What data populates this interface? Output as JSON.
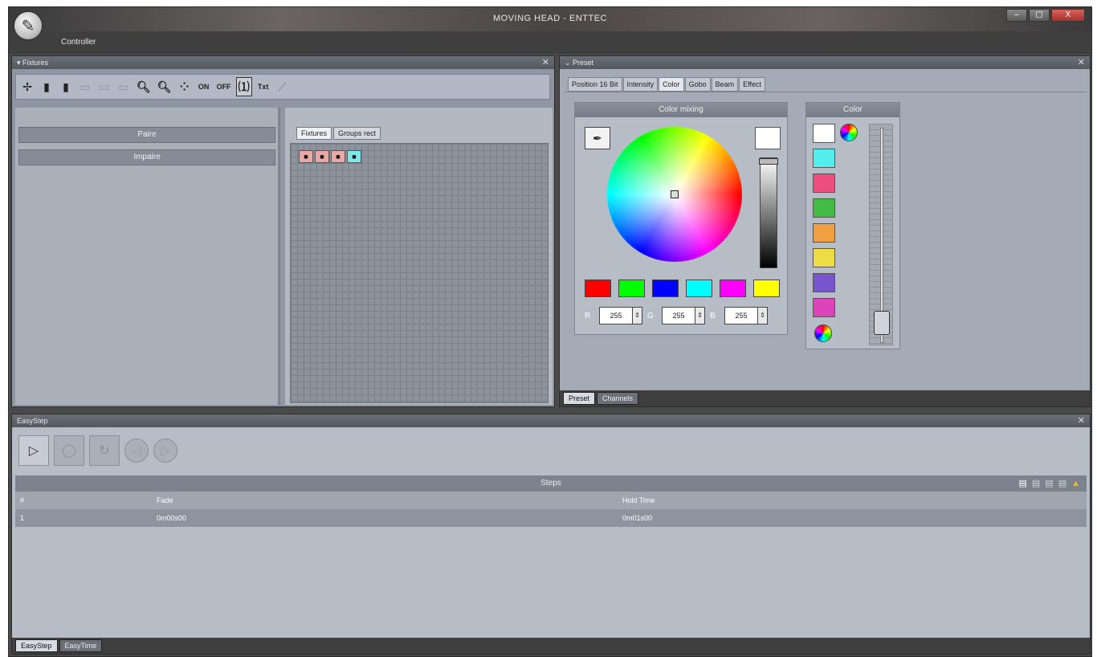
{
  "window": {
    "title": "MOVING HEAD - ENTTEC",
    "controls": [
      "–",
      "▢",
      "X"
    ]
  },
  "menu": {
    "controller_label": "Controller"
  },
  "fixtures_panel": {
    "title": "Fixtures",
    "toolbar": {
      "on_label": "ON",
      "off_label": "OFF",
      "txt_label": "Txt"
    },
    "groups": [
      "Paire",
      "Impaire"
    ],
    "tabs": [
      "Fixtures",
      "Groups rect"
    ]
  },
  "preset_panel": {
    "title": "Preset",
    "tabs": [
      "Position 16 Bit",
      "Intensity",
      "Color",
      "Gobo",
      "Beam",
      "Effect"
    ],
    "active_tab": "Color",
    "color_mixing": {
      "title": "Color mixing",
      "swatches": [
        "#ff0000",
        "#00ff00",
        "#0000ff",
        "#00ffff",
        "#ff00ff",
        "#ffff00"
      ],
      "r_label": "R",
      "g_label": "G",
      "b_label": "B",
      "r_value": "255",
      "g_value": "255",
      "b_value": "255"
    },
    "color": {
      "title": "Color",
      "swatches": [
        "#ffffff",
        "#55eeee",
        "#ee4d80",
        "#44bb44",
        "#f0a040",
        "#eedd44",
        "#7755cc",
        "#dd44bb"
      ]
    },
    "bottom_tabs": [
      "Preset",
      "Channels"
    ]
  },
  "easystep_panel": {
    "title": "EasyStep",
    "steps_title": "Steps",
    "columns": [
      "#",
      "Fade",
      "Hold Time"
    ],
    "rows": [
      {
        "num": "1",
        "fade": "0m00s00",
        "hold": "0m01s00"
      }
    ],
    "bottom_tabs": [
      "EasyStep",
      "EasyTime"
    ]
  }
}
